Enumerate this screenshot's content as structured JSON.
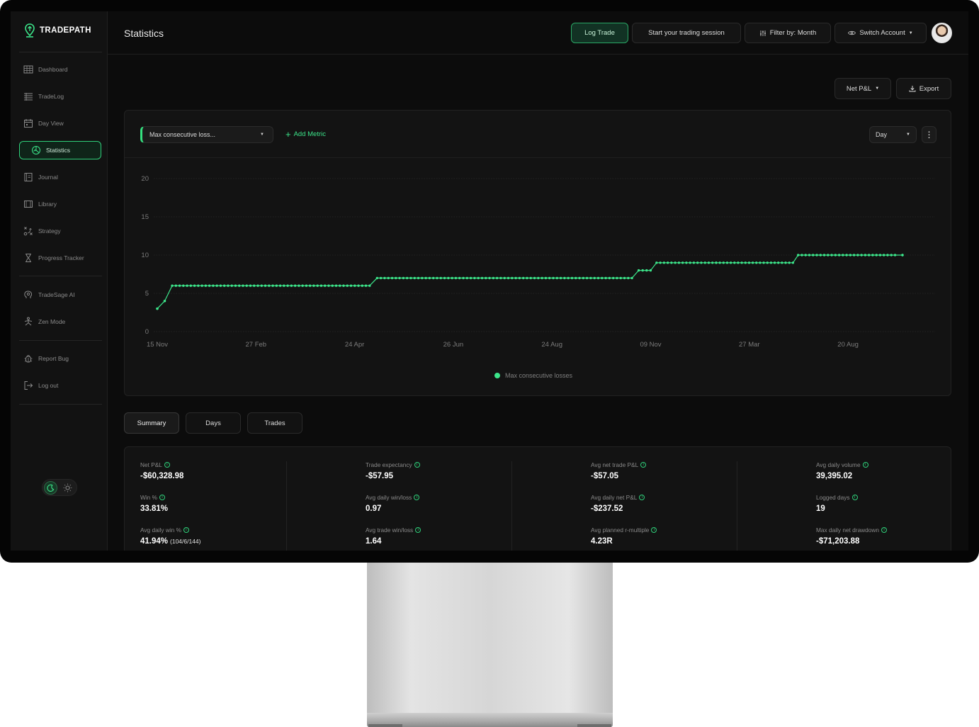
{
  "app": {
    "brand": "TRADEPATH",
    "page_title": "Statistics"
  },
  "sidebar": {
    "items": [
      {
        "label": "Dashboard",
        "icon": "grid-icon"
      },
      {
        "label": "TradeLog",
        "icon": "list-icon"
      },
      {
        "label": "Day View",
        "icon": "calendar-icon"
      },
      {
        "label": "Statistics",
        "icon": "statistics-icon",
        "active": true
      },
      {
        "label": "Journal",
        "icon": "journal-icon"
      },
      {
        "label": "Library",
        "icon": "library-icon"
      },
      {
        "label": "Strategy",
        "icon": "strategy-icon"
      },
      {
        "label": "Progress Tracker",
        "icon": "hourglass-icon"
      },
      {
        "label": "TradeSage AI",
        "icon": "brain-icon"
      },
      {
        "label": "Zen Mode",
        "icon": "meditation-icon"
      },
      {
        "label": "Report Bug",
        "icon": "bug-icon"
      },
      {
        "label": "Log out",
        "icon": "logout-icon"
      }
    ]
  },
  "topbar": {
    "log_trade": "Log Trade",
    "start_session": "Start your trading session",
    "filter": "Filter by: Month",
    "switch_account": "Switch Account"
  },
  "toolbar": {
    "net_pnl": "Net P&L",
    "export": "Export"
  },
  "chart_controls": {
    "metric_select": "Max consecutive loss...",
    "add_metric": "Add Metric",
    "period": "Day"
  },
  "colors": {
    "accent": "#3ce58a",
    "background": "#0c0c0c",
    "card": "#131313"
  },
  "chart_data": {
    "type": "line",
    "x_tick_labels": [
      "15 Nov",
      "27 Feb",
      "24 Apr",
      "26 Jun",
      "24 Aug",
      "09 Nov",
      "27 Mar",
      "20 Aug"
    ],
    "ylim": [
      0,
      20
    ],
    "y_ticks": [
      0,
      5,
      10,
      15,
      20
    ],
    "grid": true,
    "legend_position": "bottom-center",
    "series": [
      {
        "name": "Max consecutive losses",
        "color": "#3ce58a",
        "steps": [
          {
            "from": 0.0,
            "to": 0.0,
            "value": 3
          },
          {
            "from": 0.01,
            "to": 0.01,
            "value": 4
          },
          {
            "from": 0.02,
            "to": 0.285,
            "value": 6
          },
          {
            "from": 0.295,
            "to": 0.637,
            "value": 7
          },
          {
            "from": 0.646,
            "to": 0.662,
            "value": 8
          },
          {
            "from": 0.67,
            "to": 0.75,
            "value": 9
          },
          {
            "from": 0.75,
            "to": 0.853,
            "value": 9
          },
          {
            "from": 0.86,
            "to": 0.99,
            "value": 10
          },
          {
            "from": 1.0,
            "to": 1.0,
            "value": 10
          }
        ]
      }
    ]
  },
  "tabs": [
    "Summary",
    "Days",
    "Trades"
  ],
  "summary": {
    "columns": [
      [
        {
          "label": "Net P&L",
          "value": "-$60,328.98"
        },
        {
          "label": "Win %",
          "value": "33.81%"
        },
        {
          "label": "Avg daily win %",
          "value": "41.94%",
          "sub": "(104/6/144)"
        }
      ],
      [
        {
          "label": "Trade expectancy",
          "value": "-$57.95"
        },
        {
          "label": "Avg daily win/loss",
          "value": "0.97"
        },
        {
          "label": "Avg trade win/loss",
          "value": "1.64"
        }
      ],
      [
        {
          "label": "Avg net trade P&L",
          "value": "-$57.05"
        },
        {
          "label": "Avg daily net P&L",
          "value": "-$237.52"
        },
        {
          "label": "Avg planned r-multiple",
          "value": "4.23R"
        }
      ],
      [
        {
          "label": "Avg daily volume",
          "value": "39,395.02"
        },
        {
          "label": "Logged days",
          "value": "19"
        },
        {
          "label": "Max daily net drawdown",
          "value": "-$71,203.88"
        }
      ]
    ]
  }
}
